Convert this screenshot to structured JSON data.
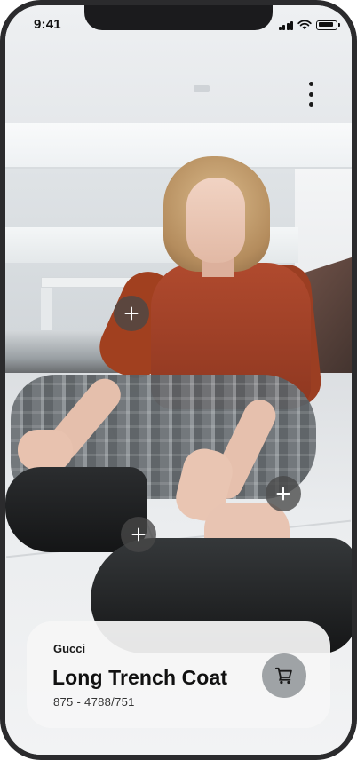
{
  "status_bar": {
    "time": "9:41"
  },
  "menu": {
    "icon": "more-vertical-icon"
  },
  "hotspots": [
    {
      "icon": "plus-icon"
    },
    {
      "icon": "plus-icon"
    },
    {
      "icon": "plus-icon"
    }
  ],
  "product": {
    "brand": "Gucci",
    "name": "Long Trench Coat",
    "code": "875 - 4788/751",
    "cart_icon": "cart-icon"
  },
  "colors": {
    "hotspot_bg": "#484848",
    "card_bg": "#f6f6f6",
    "cart_button_bg": "#9fa3a6",
    "text": "#111111"
  }
}
